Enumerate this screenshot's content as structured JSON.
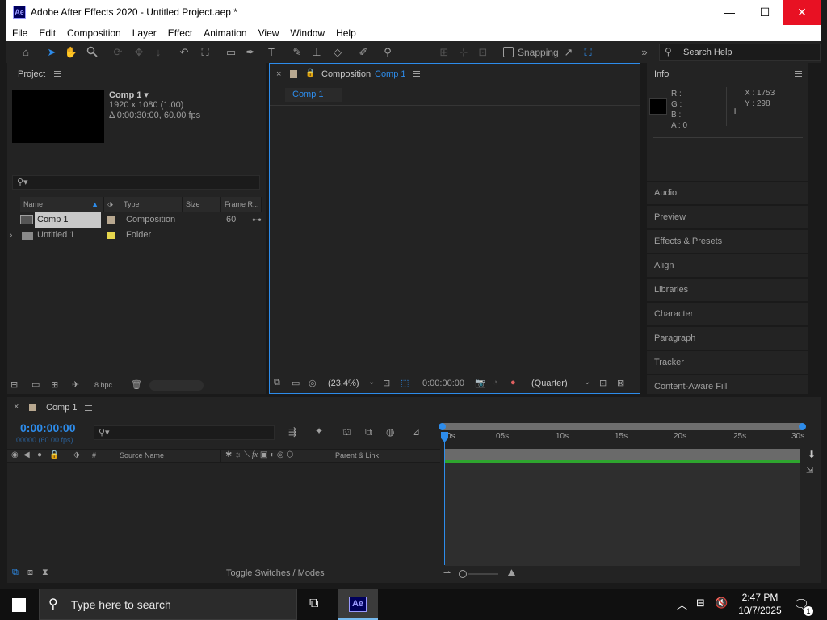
{
  "window": {
    "title": "Adobe After Effects 2020 - Untitled Project.aep *",
    "app_icon": "Ae",
    "minimize": "—",
    "maximize": "☐",
    "close": "✕"
  },
  "menu": [
    "File",
    "Edit",
    "Composition",
    "Layer",
    "Effect",
    "Animation",
    "View",
    "Window",
    "Help"
  ],
  "toolbar": {
    "snapping_label": "Snapping",
    "more": "»",
    "search_placeholder": "Search Help"
  },
  "project": {
    "title": "Project",
    "comp_name": "Comp 1 ▾",
    "comp_size": "1920 x 1080 (1.00)",
    "comp_duration": "Δ 0:00:30:00, 60.00 fps",
    "columns": [
      "Name",
      "Type",
      "Size",
      "Frame R..."
    ],
    "items": [
      {
        "name": "Comp 1",
        "type": "Composition",
        "frame_rate": "60",
        "color": "#b8a890"
      },
      {
        "name": "Untitled 1",
        "type": "Folder",
        "frame_rate": "",
        "color": "#e6d64d"
      }
    ],
    "bpc": "8 bpc"
  },
  "composition": {
    "tab_close": "×",
    "tab_prefix": "Composition",
    "tab_name": "Comp 1",
    "subtab": "Comp 1",
    "zoom": "(23.4%)",
    "timecode": "0:00:00:00",
    "resolution": "(Quarter)"
  },
  "info": {
    "title": "Info",
    "r": "R :",
    "g": "G :",
    "b": "B :",
    "a": "A : 0",
    "x": "X : 1753",
    "y": "Y : 298"
  },
  "right_panels": [
    "Audio",
    "Preview",
    "Effects & Presets",
    "Align",
    "Libraries",
    "Character",
    "Paragraph",
    "Tracker",
    "Content-Aware Fill"
  ],
  "timeline": {
    "tab_name": "Comp 1",
    "timecode": "0:00:00:00",
    "frame_info": "00000 (60.00 fps)",
    "source_name": "Source Name",
    "parent_link": "Parent & Link",
    "hash": "#",
    "ruler": [
      "0s",
      "05s",
      "10s",
      "15s",
      "20s",
      "25s",
      "30s"
    ],
    "toggle": "Toggle Switches / Modes"
  },
  "taskbar": {
    "search_placeholder": "Type here to search",
    "time": "2:47 PM",
    "date": "10/7/2025",
    "notification_count": "1"
  }
}
